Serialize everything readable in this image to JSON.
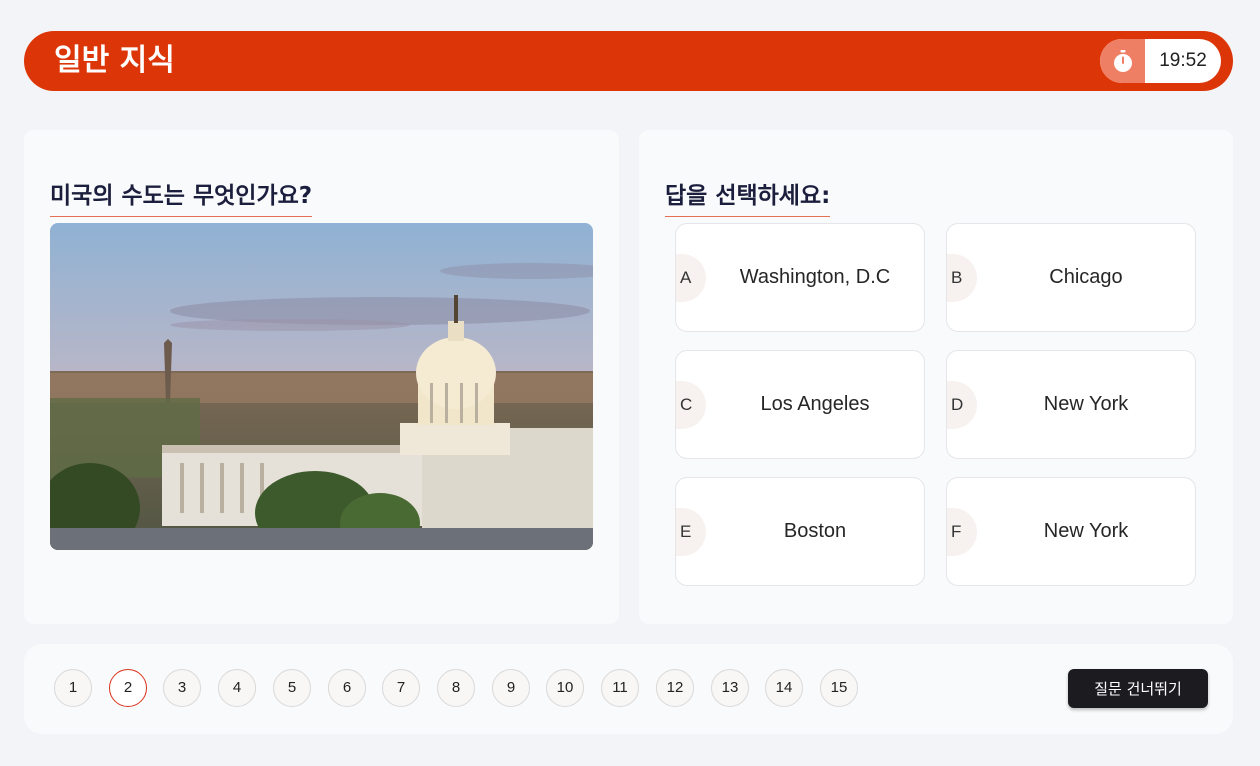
{
  "header": {
    "title": "일반 지식",
    "timer": {
      "icon": "stopwatch-icon",
      "time": "19:52"
    }
  },
  "question": {
    "heading": "미국의 수도는 무엇인가요?",
    "image": "capitol-building-photo"
  },
  "answers": {
    "heading": "답을 선택하세요:",
    "options": [
      {
        "letter": "A",
        "text": "Washington, D.C"
      },
      {
        "letter": "B",
        "text": "Chicago"
      },
      {
        "letter": "C",
        "text": "Los Angeles"
      },
      {
        "letter": "D",
        "text": "New York"
      },
      {
        "letter": "E",
        "text": "Boston"
      },
      {
        "letter": "F",
        "text": "New York"
      }
    ]
  },
  "footer": {
    "pages": [
      "1",
      "2",
      "3",
      "4",
      "5",
      "6",
      "7",
      "8",
      "9",
      "10",
      "11",
      "12",
      "13",
      "14",
      "15"
    ],
    "current_page": "2",
    "skip_label": "질문 건너뛰기"
  },
  "colors": {
    "accent": "#dc3608",
    "timer_icon_bg": "#ee7f64",
    "heading_text": "#1c1e3d",
    "skip_button": "#1c1b1f"
  }
}
